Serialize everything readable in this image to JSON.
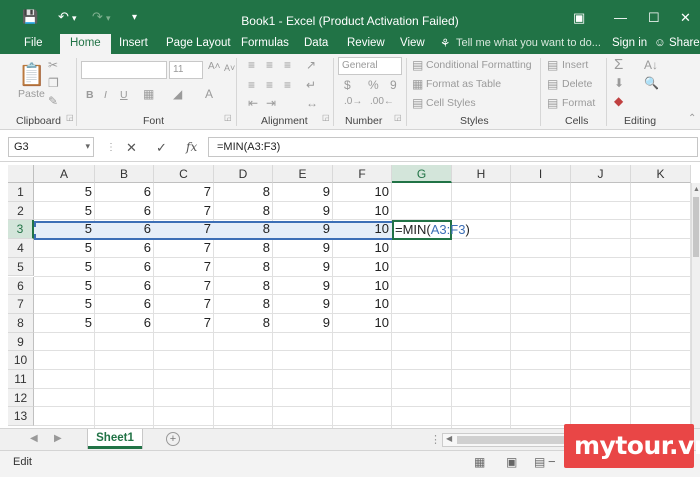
{
  "titlebar": {
    "title": "Book1 - Excel (Product Activation Failed)",
    "qa_save_icon": "save-icon",
    "undo_icon": "undo-icon",
    "redo_icon": "redo-icon",
    "customize_icon": "customize-qat-icon"
  },
  "tabs": {
    "file": "File",
    "home": "Home",
    "insert": "Insert",
    "page_layout": "Page Layout",
    "formulas": "Formulas",
    "data": "Data",
    "review": "Review",
    "view": "View",
    "tell_me": "Tell me what you want to do...",
    "sign_in": "Sign in",
    "share": "Share"
  },
  "ribbon": {
    "clipboard": {
      "label": "Clipboard",
      "paste": "Paste"
    },
    "font": {
      "label": "Font",
      "size": "11",
      "bold": "B",
      "italic": "I",
      "underline": "U"
    },
    "alignment": {
      "label": "Alignment"
    },
    "number": {
      "label": "Number",
      "format": "General",
      "currency": "$",
      "percent": "%",
      "comma": "9"
    },
    "styles": {
      "label": "Styles",
      "conditional": "Conditional Formatting",
      "format_table": "Format as Table",
      "cell_styles": "Cell Styles"
    },
    "cells": {
      "label": "Cells",
      "insert": "Insert",
      "delete": "Delete",
      "format": "Format"
    },
    "editing": {
      "label": "Editing"
    }
  },
  "formula_bar": {
    "name_box": "G3",
    "formula": "=MIN(A3:F3)",
    "fx": "fx"
  },
  "grid": {
    "columns": [
      "A",
      "B",
      "C",
      "D",
      "E",
      "F",
      "G",
      "H",
      "I",
      "J",
      "K"
    ],
    "rows": [
      "1",
      "2",
      "3",
      "4",
      "5",
      "6",
      "7",
      "8",
      "9",
      "10",
      "11",
      "12",
      "13"
    ],
    "values": [
      [
        "5",
        "6",
        "7",
        "8",
        "9",
        "10"
      ],
      [
        "5",
        "6",
        "7",
        "8",
        "9",
        "10"
      ],
      [
        "5",
        "6",
        "7",
        "8",
        "9",
        "10"
      ],
      [
        "5",
        "6",
        "7",
        "8",
        "9",
        "10"
      ],
      [
        "5",
        "6",
        "7",
        "8",
        "9",
        "10"
      ],
      [
        "5",
        "6",
        "7",
        "8",
        "9",
        "10"
      ],
      [
        "5",
        "6",
        "7",
        "8",
        "9",
        "10"
      ],
      [
        "5",
        "6",
        "7",
        "8",
        "9",
        "10"
      ]
    ],
    "active_cell": "G3",
    "edit_prefix": "=MIN(",
    "edit_ref": "A3:F3",
    "edit_suffix": ")"
  },
  "sheets": {
    "tabs": [
      "Sheet1"
    ],
    "add": "+"
  },
  "status": {
    "mode": "Edit"
  },
  "watermark": "mytour.vn",
  "colors": {
    "accent": "#217346",
    "ref_blue": "#3d6fb6",
    "watermark": "#e94646"
  }
}
